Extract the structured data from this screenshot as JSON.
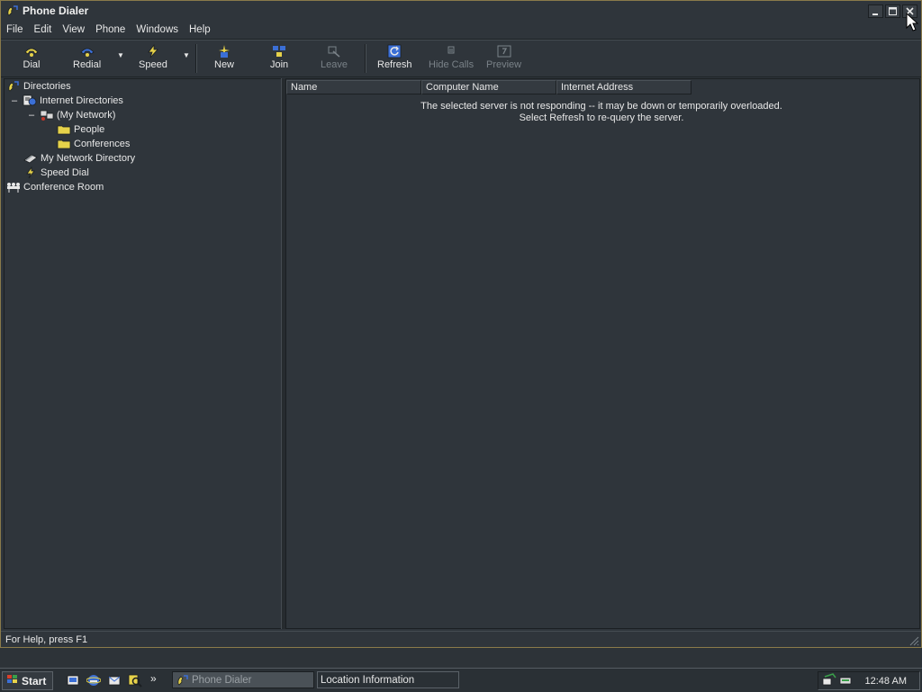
{
  "window": {
    "title": "Phone Dialer",
    "controls": [
      "minimize",
      "maximize",
      "close"
    ]
  },
  "menu": [
    "File",
    "Edit",
    "View",
    "Phone",
    "Windows",
    "Help"
  ],
  "toolbar": [
    {
      "label": "Dial",
      "icon": "dial-icon",
      "enabled": true
    },
    {
      "label": "Redial",
      "icon": "redial-icon",
      "enabled": true
    },
    {
      "label": "Speed",
      "icon": "speed-dial-icon",
      "enabled": true
    },
    {
      "label": "New",
      "icon": "new-conference-icon",
      "enabled": true
    },
    {
      "label": "Join",
      "icon": "join-icon",
      "enabled": true
    },
    {
      "label": "Leave",
      "icon": "leave-icon",
      "enabled": false
    },
    {
      "label": "Refresh",
      "icon": "refresh-icon",
      "enabled": true
    },
    {
      "label": "Hide Calls",
      "icon": "hide-calls-icon",
      "enabled": false
    },
    {
      "label": "Preview",
      "icon": "preview-icon",
      "enabled": false
    }
  ],
  "tree": [
    {
      "label": "Directories",
      "icon": "phone-directory-icon"
    },
    {
      "label": "Internet Directories",
      "icon": "internet-directories-icon",
      "toggle": "–"
    },
    {
      "label": "(My Network)",
      "icon": "network-icon",
      "toggle": "–"
    },
    {
      "label": "People",
      "icon": "folder-icon"
    },
    {
      "label": "Conferences",
      "icon": "folder-icon"
    },
    {
      "label": "My Network Directory",
      "icon": "network-directory-icon"
    },
    {
      "label": "Speed Dial",
      "icon": "speed-dial-icon"
    },
    {
      "label": "Conference Room",
      "icon": "conference-room-icon"
    }
  ],
  "list": {
    "columns": [
      "Name",
      "Computer Name",
      "Internet Address"
    ],
    "message_line1": "The selected server is not responding -- it may be down or temporarily overloaded.",
    "message_line2": "Select Refresh to re-query the server."
  },
  "status": "For Help, press F1",
  "taskbar": {
    "start": "Start",
    "quick_launch": [
      "show-desktop-icon",
      "internet-explorer-icon",
      "outlook-express-icon",
      "search-icon"
    ],
    "overflow": "»",
    "tasks": [
      {
        "label": "Phone Dialer",
        "active": true
      },
      {
        "label": "Location Information",
        "active": false
      }
    ],
    "clock": "12:48 AM"
  },
  "colors": {
    "background": "#2f353b",
    "text": "#e8e8e8",
    "icon_yellow": "#e6d24a",
    "icon_blue": "#3b6fd6"
  }
}
